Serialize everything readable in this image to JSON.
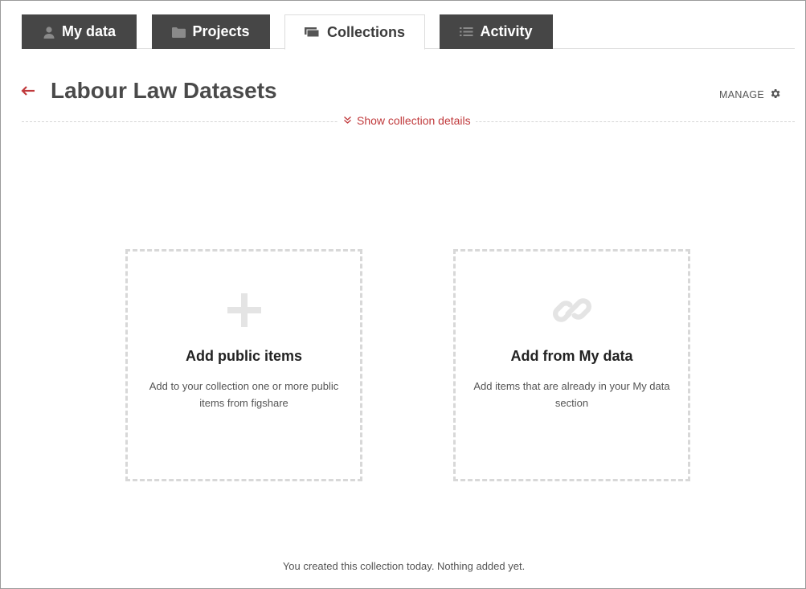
{
  "tabs": [
    {
      "label": "My data",
      "icon": "user-icon",
      "active": false
    },
    {
      "label": "Projects",
      "icon": "folder-icon",
      "active": false
    },
    {
      "label": "Collections",
      "icon": "collections-icon",
      "active": true
    },
    {
      "label": "Activity",
      "icon": "list-icon",
      "active": false
    }
  ],
  "header": {
    "title": "Labour Law Datasets",
    "manage_label": "MANAGE"
  },
  "details": {
    "toggle_label": "Show collection details"
  },
  "cards": [
    {
      "title": "Add public items",
      "description": "Add to your collection one or more public items from figshare",
      "icon": "plus-icon"
    },
    {
      "title": "Add from My data",
      "description": "Add items that are already in your My data section",
      "icon": "link-icon"
    }
  ],
  "footer": {
    "note": "You created this collection today. Nothing added yet."
  },
  "colors": {
    "tab_dark": "#464646",
    "accent_red": "#c0393b",
    "dashed_border": "#d8d8d8"
  }
}
